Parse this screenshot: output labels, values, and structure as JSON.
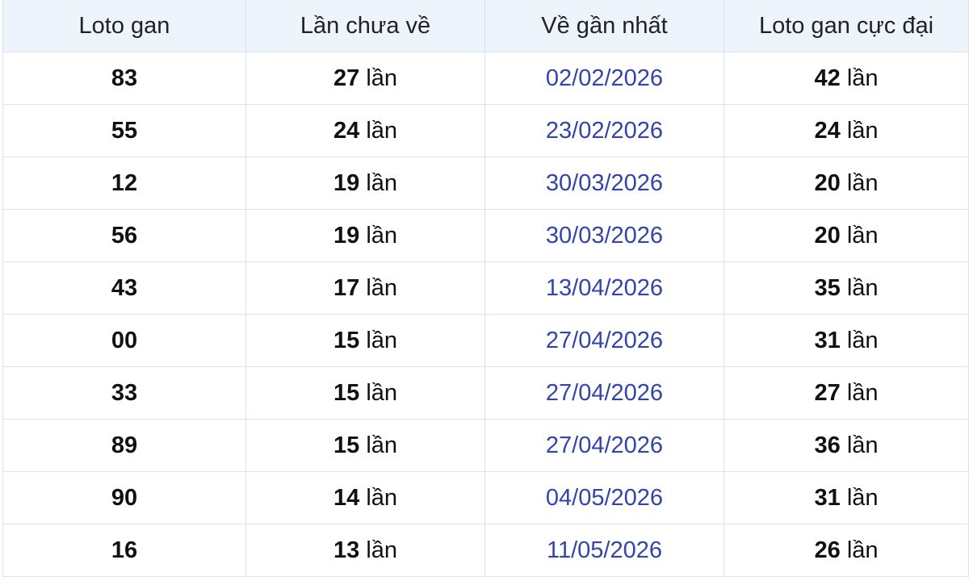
{
  "table": {
    "headers": [
      "Loto gan",
      "Lần chưa về",
      "Về gần nhất",
      "Loto gan cực đại"
    ],
    "unit": "lần",
    "rows": [
      {
        "number": "83",
        "misses": "27",
        "last_date": "02/02/2026",
        "max_gap": "42"
      },
      {
        "number": "55",
        "misses": "24",
        "last_date": "23/02/2026",
        "max_gap": "24"
      },
      {
        "number": "12",
        "misses": "19",
        "last_date": "30/03/2026",
        "max_gap": "20"
      },
      {
        "number": "56",
        "misses": "19",
        "last_date": "30/03/2026",
        "max_gap": "20"
      },
      {
        "number": "43",
        "misses": "17",
        "last_date": "13/04/2026",
        "max_gap": "35"
      },
      {
        "number": "00",
        "misses": "15",
        "last_date": "27/04/2026",
        "max_gap": "31"
      },
      {
        "number": "33",
        "misses": "15",
        "last_date": "27/04/2026",
        "max_gap": "27"
      },
      {
        "number": "89",
        "misses": "15",
        "last_date": "27/04/2026",
        "max_gap": "36"
      },
      {
        "number": "90",
        "misses": "14",
        "last_date": "04/05/2026",
        "max_gap": "31"
      },
      {
        "number": "16",
        "misses": "13",
        "last_date": "11/05/2026",
        "max_gap": "26"
      }
    ]
  },
  "colors": {
    "header_bg": "#eef4fb",
    "date_link": "#3344aa",
    "border": "#dfe3e8"
  }
}
